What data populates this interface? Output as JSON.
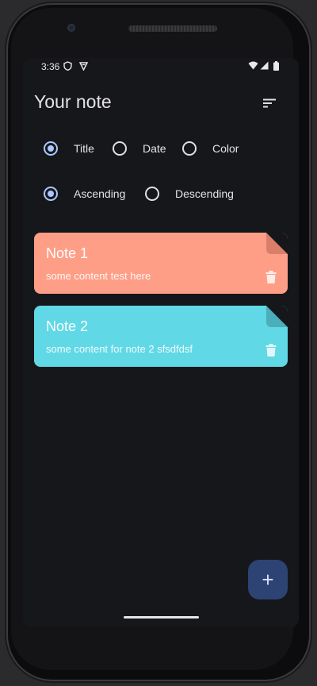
{
  "status_bar": {
    "time": "3:36"
  },
  "header": {
    "title": "Your note"
  },
  "sort_by": {
    "options": [
      {
        "label": "Title",
        "selected": true
      },
      {
        "label": "Date",
        "selected": false
      },
      {
        "label": "Color",
        "selected": false
      }
    ]
  },
  "order": {
    "options": [
      {
        "label": "Ascending",
        "selected": true
      },
      {
        "label": "Descending",
        "selected": false
      }
    ]
  },
  "notes": [
    {
      "title": "Note 1",
      "content": "some content test here",
      "color": "#ff9e87",
      "fold_color": "#d97e6a"
    },
    {
      "title": "Note 2",
      "content": "some content for note 2 sfsdfdsf",
      "color": "#61d8e5",
      "fold_color": "#4aafbb"
    }
  ],
  "fab": {
    "label": "+"
  },
  "colors": {
    "background": "#16171b",
    "accent": "#aac7ff",
    "fab": "#2c4373"
  }
}
